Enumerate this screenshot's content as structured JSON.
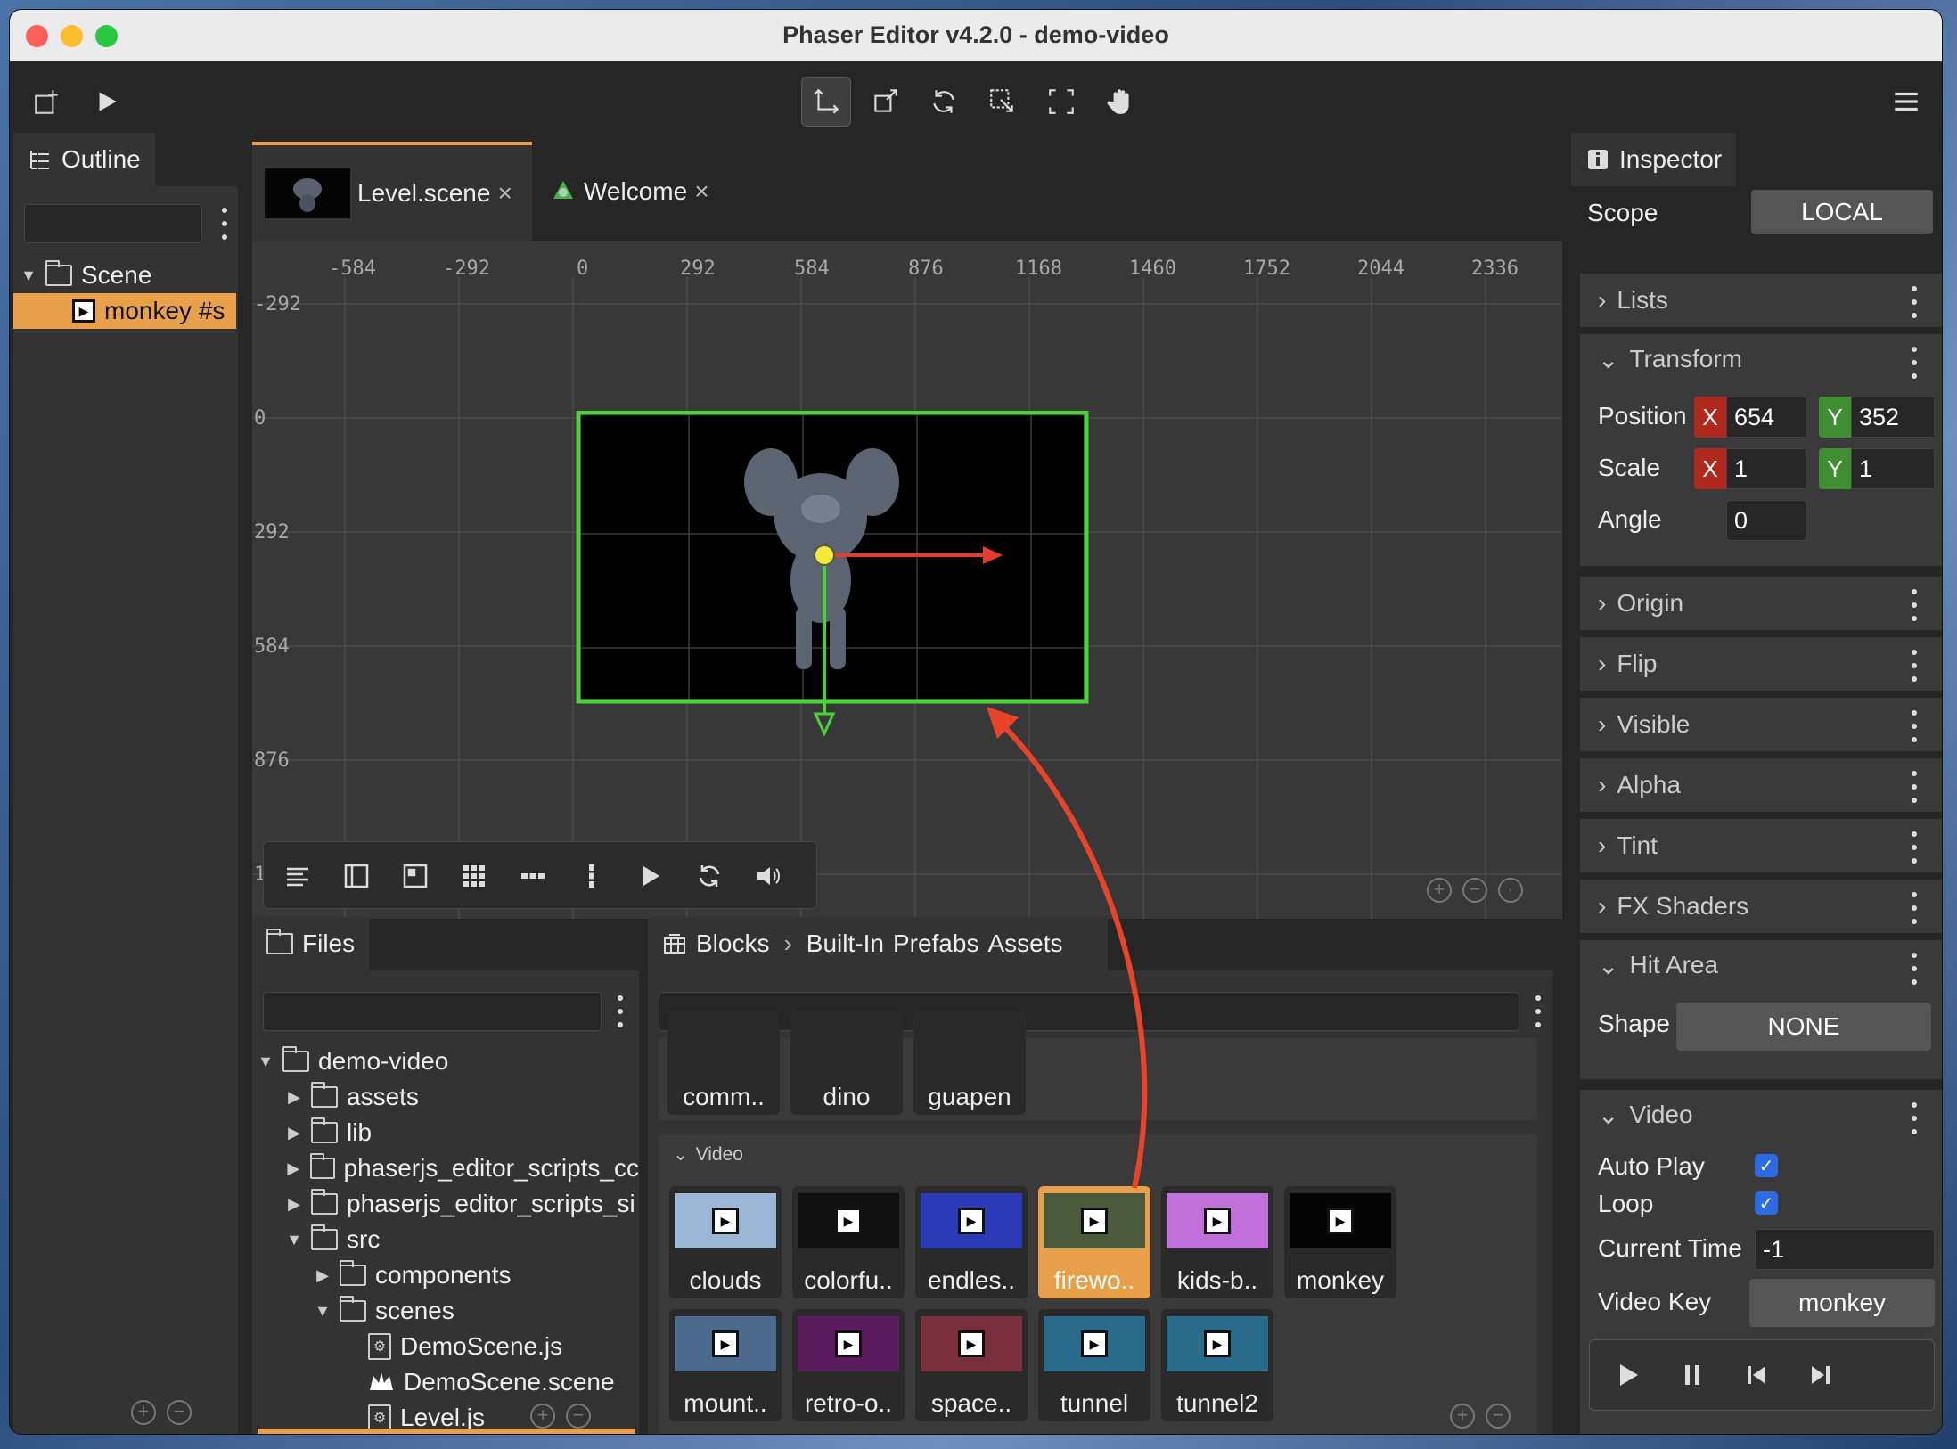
{
  "window": {
    "title": "Phaser Editor v4.2.0 - demo-video"
  },
  "toolbar": {
    "left_icons": [
      "add-scene-icon",
      "play-icon"
    ],
    "center_icons": [
      "translate-tool-icon",
      "scale-tool-icon",
      "rotate-tool-icon",
      "origin-tool-icon",
      "select-region-icon",
      "pan-tool-icon"
    ],
    "menu_icon": "hamburger-menu-icon"
  },
  "outline": {
    "tab_label": "Outline",
    "search_placeholder": "",
    "tree": {
      "scene": "Scene",
      "selected_item": "monkey  #s"
    }
  },
  "editor": {
    "tabs": [
      {
        "label": "Level.scene",
        "active": true
      },
      {
        "label": "Welcome",
        "active": false
      }
    ],
    "close_glyph": "×",
    "ruler_x": [
      "-584",
      "-292",
      "0",
      "292",
      "584",
      "876",
      "1168",
      "1460",
      "1752",
      "2044",
      "2336"
    ],
    "ruler_y": [
      "-292",
      "0",
      "292",
      "584",
      "876",
      "1"
    ]
  },
  "files": {
    "tab_label": "Files",
    "tree": [
      {
        "label": "demo-video",
        "type": "folder",
        "expanded": true,
        "depth": 0
      },
      {
        "label": "assets",
        "type": "folder",
        "expanded": false,
        "depth": 1
      },
      {
        "label": "lib",
        "type": "folder",
        "expanded": false,
        "depth": 1
      },
      {
        "label": "phaserjs_editor_scripts_cc",
        "type": "folder",
        "expanded": false,
        "depth": 1
      },
      {
        "label": "phaserjs_editor_scripts_si",
        "type": "folder",
        "expanded": false,
        "depth": 1
      },
      {
        "label": "src",
        "type": "folder",
        "expanded": true,
        "depth": 1
      },
      {
        "label": "components",
        "type": "folder",
        "expanded": false,
        "depth": 2
      },
      {
        "label": "scenes",
        "type": "folder",
        "expanded": true,
        "depth": 2
      },
      {
        "label": "DemoScene.js",
        "type": "js",
        "depth": 3
      },
      {
        "label": "DemoScene.scene",
        "type": "scene",
        "depth": 3
      },
      {
        "label": "Level.js",
        "type": "js",
        "depth": 3
      }
    ]
  },
  "blocks": {
    "tab_label": "Blocks",
    "breadcrumb": [
      "Built-In",
      "Prefabs",
      "Assets"
    ],
    "top_row": [
      "comm..",
      "dino",
      "guapen"
    ],
    "section_label": "Video",
    "videos": [
      {
        "label": "clouds",
        "color": "#9cb6d6"
      },
      {
        "label": "colorfu..",
        "color": "#111111"
      },
      {
        "label": "endles..",
        "color": "#2b3bb8"
      },
      {
        "label": "firewo..",
        "color": "#4a5a3a",
        "selected": true
      },
      {
        "label": "kids-b..",
        "color": "#c070d8"
      },
      {
        "label": "monkey",
        "color": "#050505"
      },
      {
        "label": "mount..",
        "color": "#4c6b8c"
      },
      {
        "label": "retro-o..",
        "color": "#5a1c5c"
      },
      {
        "label": "space..",
        "color": "#7a2f3c"
      },
      {
        "label": "tunnel",
        "color": "#2a6a8a"
      },
      {
        "label": "tunnel2",
        "color": "#2a6a8a"
      }
    ]
  },
  "inspector": {
    "tab_label": "Inspector",
    "scope_label": "Scope",
    "scope_value": "LOCAL",
    "sections": {
      "lists": "Lists",
      "transform": "Transform",
      "origin": "Origin",
      "flip": "Flip",
      "visible": "Visible",
      "alpha": "Alpha",
      "tint": "Tint",
      "fx_shaders": "FX Shaders",
      "hit_area": "Hit Area",
      "video": "Video"
    },
    "transform": {
      "position_label": "Position",
      "pos_x": "654",
      "pos_y": "352",
      "scale_label": "Scale",
      "scale_x": "1",
      "scale_y": "1",
      "angle_label": "Angle",
      "angle": "0",
      "x_axis": "X",
      "y_axis": "Y"
    },
    "hit_area": {
      "shape_label": "Shape",
      "shape_value": "NONE"
    },
    "video": {
      "auto_play_label": "Auto Play",
      "auto_play": true,
      "loop_label": "Loop",
      "loop": true,
      "current_time_label": "Current Time",
      "current_time": "-1",
      "video_key_label": "Video Key",
      "video_key": "monkey"
    }
  },
  "colors": {
    "accent": "#e8a04b",
    "selection_green": "#4cd13a",
    "axis_red": "#e63b2e"
  }
}
